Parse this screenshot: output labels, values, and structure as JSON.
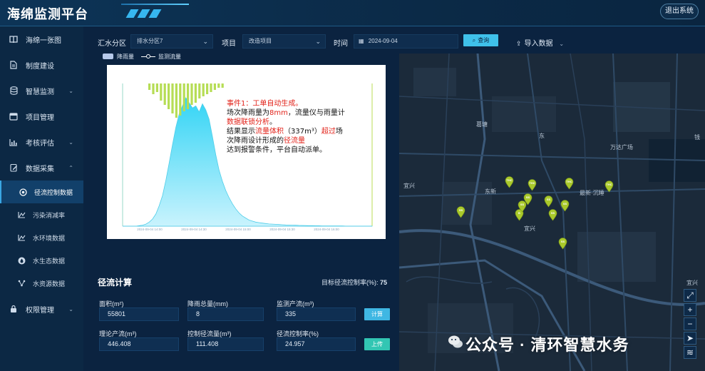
{
  "app": {
    "title": "海绵监测平台",
    "logout_label": "退出系统"
  },
  "sidebar": {
    "items": [
      {
        "label": "海绵一张图",
        "icon": "book-icon"
      },
      {
        "label": "制度建设",
        "icon": "document-icon"
      },
      {
        "label": "智慧监测",
        "icon": "database-icon"
      },
      {
        "label": "项目管理",
        "icon": "window-icon"
      },
      {
        "label": "考核评估",
        "icon": "bar-chart-icon"
      },
      {
        "label": "数据采集",
        "icon": "edit-icon"
      }
    ],
    "sub_items": [
      {
        "label": "径流控制数据",
        "icon": "target-icon",
        "active": true
      },
      {
        "label": "污染消减率",
        "icon": "trend-icon"
      },
      {
        "label": "水环境数据",
        "icon": "trend-icon"
      },
      {
        "label": "水生态数据",
        "icon": "drop-icon"
      },
      {
        "label": "水资源数据",
        "icon": "network-icon"
      }
    ],
    "permission_label": "权限管理"
  },
  "filters": {
    "catchment_label": "汇水分区",
    "catchment_value": "排水分区7",
    "project_label": "项目",
    "project_value": "改造项目",
    "time_label": "时间",
    "time_value": "2024-09-04",
    "query_label": "查询",
    "import_label": "导入数据"
  },
  "legend": {
    "rain": "降雨量",
    "flow": "监测流量"
  },
  "chart_data": {
    "type": "area",
    "title": "",
    "series": [
      {
        "name": "降雨量",
        "type": "bar",
        "color": "#b6dd55",
        "values": [
          3,
          5,
          4,
          8,
          10,
          12,
          14,
          16,
          15,
          13,
          12,
          10,
          9,
          7,
          6,
          5,
          4,
          3,
          2,
          2
        ]
      },
      {
        "name": "监测流量",
        "type": "area",
        "color": "#5fdcf6",
        "values": [
          0,
          0,
          0,
          0,
          0,
          0.5,
          1,
          2,
          4,
          7,
          12,
          20,
          30,
          45,
          62,
          80,
          97,
          110,
          118,
          126,
          121,
          116,
          118,
          112,
          120,
          114,
          105,
          88,
          70,
          55,
          44,
          35,
          28,
          22,
          17,
          13,
          10,
          8,
          6,
          5,
          4,
          3.5,
          3,
          2.6,
          2.2,
          2,
          1.8,
          1.6,
          1.4,
          1.2,
          1.1,
          1,
          0.9,
          0.8,
          0.7,
          0.6,
          0.5,
          0.5,
          0.4,
          0.4,
          0.3,
          0.3,
          0.3,
          0.2,
          0.2,
          0.2,
          0.2,
          0.1,
          0.1,
          0.1,
          0.1,
          0.1,
          0.1,
          0.1,
          0.1,
          0.1
        ]
      }
    ],
    "x_ticks": [
      "2024-09-04 14:00",
      "2024-09-04 14:30",
      "2024-09-04 15:00",
      "2024-09-04 15:30",
      "2024-09-04 16:00"
    ],
    "y_max": 140,
    "grid": false
  },
  "annotation": {
    "l1": "事件1：工单自动生成。",
    "l2a": "场次降雨量为",
    "l2b": "8mm",
    "l2c": "，流量仪与雨量计",
    "l3": "数据联锁分析",
    "l3b": "。",
    "l4a": "结果显示",
    "l4b": "流量体积",
    "l4c": "（337m³）",
    "l4d": "超过",
    "l4e": "场",
    "l5a": "次降雨设计形成的",
    "l5b": "径流量",
    "l6": "达到报警条件，平台自动派单。"
  },
  "runoff": {
    "title": "径流计算",
    "target_label": "目标径流控制率(%):",
    "target_value": "75",
    "fields": [
      {
        "label": "面积(m²)",
        "value": "55801"
      },
      {
        "label": "降雨总量(mm)",
        "value": "8"
      },
      {
        "label": "监测产流(m³)",
        "value": "335"
      },
      {
        "label": "理论产流(m³)",
        "value": "446.408"
      },
      {
        "label": "控制径流量(m³)",
        "value": "111.408"
      },
      {
        "label": "径流控制率(%)",
        "value": "24.957"
      }
    ],
    "calc_label": "计算",
    "upload_label": "上传"
  },
  "map": {
    "labels": [
      "葛塘",
      "东",
      "万达广场",
      "钱",
      "宜兴",
      "东新",
      "最新·沉睡",
      "宜兴",
      "宜兴"
    ],
    "marker_labels": [
      "SS",
      "THC",
      "THC",
      "THC",
      "THC",
      "SS",
      "SS",
      "B",
      "SS",
      "SS",
      "SS",
      "SS"
    ]
  },
  "watermark": "公众号 · 清环智慧水务"
}
